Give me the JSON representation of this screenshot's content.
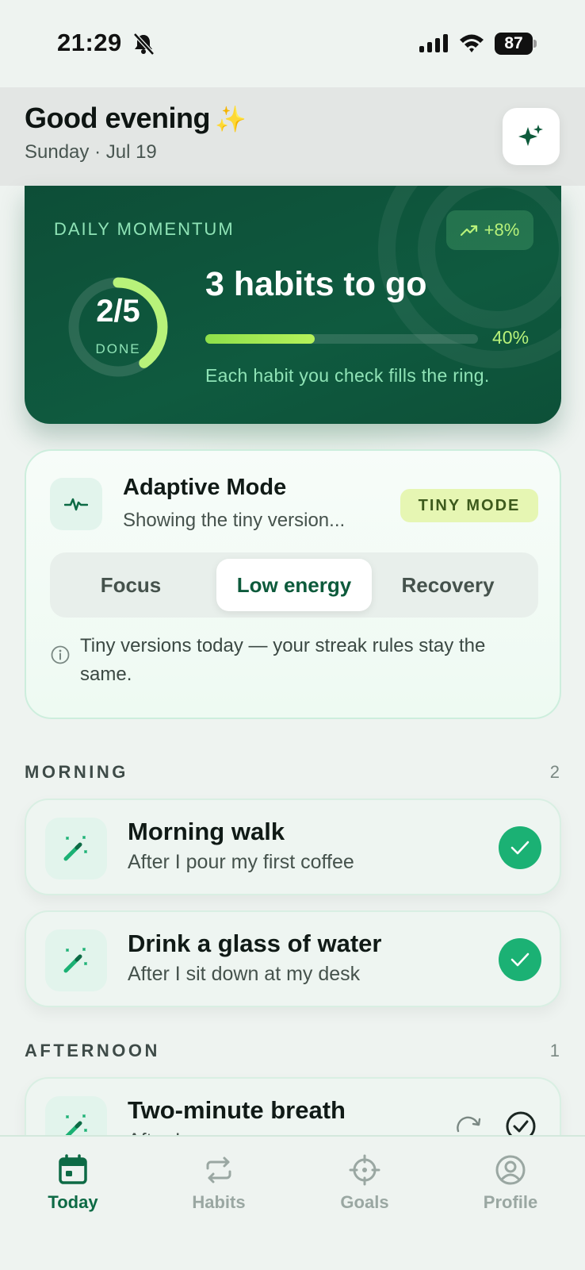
{
  "status_bar": {
    "time": "21:29",
    "battery": "87"
  },
  "header": {
    "greeting": "Good evening",
    "greeting_emoji": "✨",
    "date": "Sunday · Jul 19"
  },
  "momentum": {
    "label": "DAILY MOMENTUM",
    "trend": "+8%",
    "done_count": "2/5",
    "done_label": "DONE",
    "headline": "3 habits to go",
    "progress_percent": 40,
    "progress_label": "40%",
    "hint": "Each habit you check fills the ring."
  },
  "adaptive": {
    "title": "Adaptive Mode",
    "subtitle": "Showing the tiny version...",
    "badge": "TINY MODE",
    "segments": [
      "Focus",
      "Low energy",
      "Recovery"
    ],
    "active_segment": "Low energy",
    "info": "Tiny versions today — your streak rules stay the same."
  },
  "sections": [
    {
      "title": "MORNING",
      "count": "2",
      "habits": [
        {
          "name": "Morning walk",
          "cue": "After I pour my first coffee",
          "done": true
        },
        {
          "name": "Drink a glass of water",
          "cue": "After I sit down at my desk",
          "done": true
        }
      ]
    },
    {
      "title": "AFTERNOON",
      "count": "1",
      "habits": [
        {
          "name": "Two-minute breath",
          "cue": "After I...",
          "done": false
        }
      ]
    }
  ],
  "tabs": [
    {
      "label": "Today",
      "icon": "calendar-icon",
      "active": true
    },
    {
      "label": "Habits",
      "icon": "repeat-icon",
      "active": false
    },
    {
      "label": "Goals",
      "icon": "crosshair-icon",
      "active": false
    },
    {
      "label": "Profile",
      "icon": "user-circle-icon",
      "active": false
    }
  ],
  "colors": {
    "accent": "#0d5a3b",
    "success": "#1bb174",
    "lime": "#b8f27a"
  }
}
